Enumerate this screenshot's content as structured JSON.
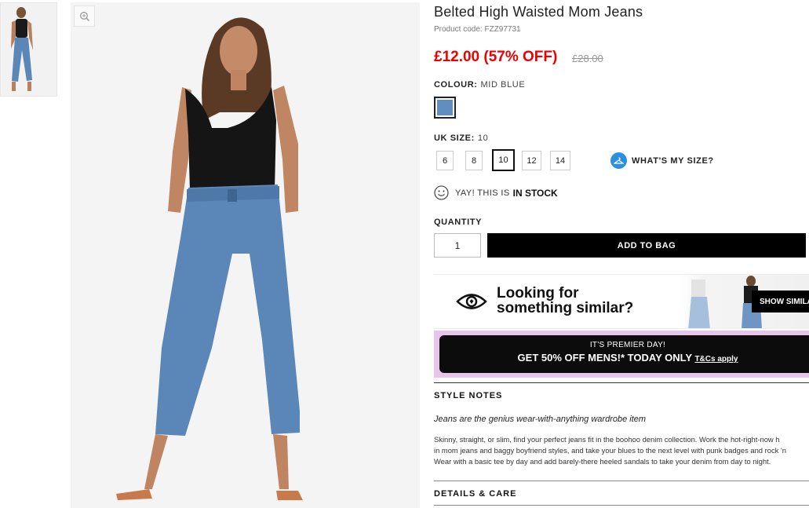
{
  "product": {
    "title": "Belted High Waisted Mom Jeans",
    "code": "Product code: FZZ97731",
    "price": "£12.00 (57% OFF)",
    "old_price": "£28.00"
  },
  "colour": {
    "label": "COLOUR:",
    "value": "MID BLUE",
    "swatch_color": "#5f8fbe"
  },
  "size": {
    "label": "UK SIZE:",
    "value": "10",
    "options": [
      "6",
      "8",
      "10",
      "12",
      "14"
    ],
    "selected": "10",
    "whats_my_size": "WHAT'S MY SIZE?"
  },
  "stock": {
    "prefix": "YAY! THIS IS",
    "status": "IN STOCK"
  },
  "quantity": {
    "label": "QUANTITY",
    "value": "1"
  },
  "add_to_bag": "ADD TO BAG",
  "similar": {
    "line1": "Looking for",
    "line2": "something similar?",
    "button": "SHOW SIMILAR"
  },
  "promo": {
    "line1": "IT'S PREMIER DAY!",
    "line2": "GET 50% OFF MENS!* TODAY ONLY",
    "terms": "T&Cs apply",
    "bg_color": "#e8c4ec"
  },
  "style_notes": {
    "heading": "STYLE NOTES",
    "lead": "Jeans are the genius wear-with-anything wardrobe item",
    "body": [
      "Skinny, straight, or slim, find your perfect jeans fit in the boohoo denim collection. Work the hot-right-now h",
      "in mom jeans and baggy boyfriend styles, and take your blues to the next level with punk badges and rock 'n",
      "Wear with a basic tee by day and add barely-there heeled sandals to take your denim from day to night."
    ]
  },
  "details_care": {
    "heading": "DETAILS & CARE"
  },
  "colors": {
    "price_red": "#e00000",
    "accent_blue": "#2d8fe0",
    "denim": "#5b86b8"
  }
}
